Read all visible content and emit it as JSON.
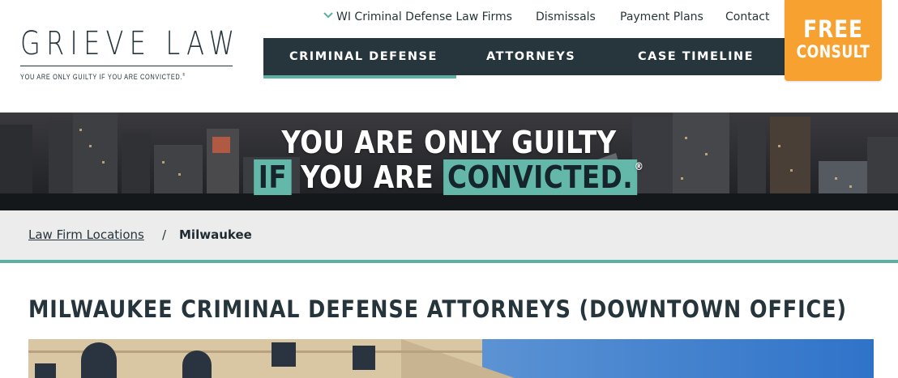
{
  "logo": {
    "name": "GRIEVE LAW",
    "tagline": "YOU ARE ONLY GUILTY IF YOU ARE CONVICTED.",
    "tagline_mark": "®"
  },
  "utility_nav": [
    {
      "label": "WI Criminal Defense Law Firms",
      "icon": "chevron-down-icon"
    },
    {
      "label": "Dismissals"
    },
    {
      "label": "Payment Plans"
    },
    {
      "label": "Contact"
    }
  ],
  "main_nav": {
    "items": [
      {
        "label": "CRIMINAL DEFENSE",
        "active": true
      },
      {
        "label": "ATTORNEYS"
      },
      {
        "label": "CASE TIMELINE"
      }
    ]
  },
  "cta": {
    "line1": "FREE",
    "line2": "CONSULT"
  },
  "hero": {
    "line1": "YOU ARE ONLY GUILTY",
    "line2_highlight_1": "IF",
    "line2_text": "YOU ARE",
    "line2_highlight_2": "CONVICTED.",
    "mark": "®"
  },
  "breadcrumb": {
    "link": "Law Firm Locations",
    "separator": "/",
    "current": "Milwaukee"
  },
  "page": {
    "title": "MILWAUKEE CRIMINAL DEFENSE ATTORNEYS (DOWNTOWN OFFICE)"
  },
  "colors": {
    "dark_nav": "#26363c",
    "teal_accent": "#5bb0a4",
    "cta_orange": "#f7a230",
    "breadcrumb_bg": "#ececec"
  }
}
